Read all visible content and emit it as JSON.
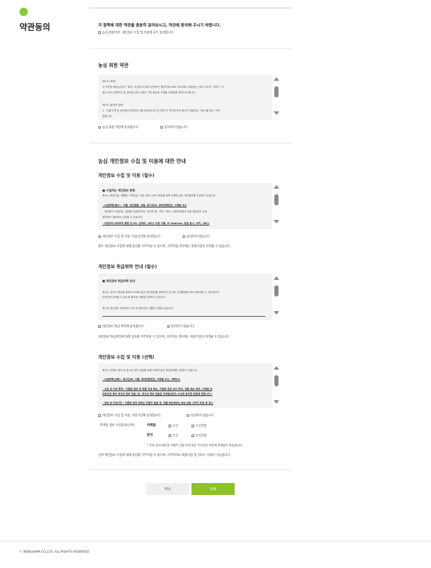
{
  "sidebar": {
    "title": "약관동의"
  },
  "intro": {
    "headline": "각 항목에 대한 약관을 충분히 읽어보시고, 약관에 동의해 주시기 바랍니다.",
    "agree_all": "농심 회원약관, 개인정보 수집 및 이용에 모두 동의합니다."
  },
  "member_terms": {
    "title": "농심 회원 약관",
    "lines": [
      "제1조 (목적)",
      "이 약관은 ㈜농심(이하 \"회사\" 라 합니다)에서 운영하는 웹사이트(Web Site)에서 제공하는 서비스(이하 \"서비스\" 라",
      "합니다)의 이용조건 및 절차에 관한 사항과 기타 필요한 사항을 규정함을 목적으로 합니다.",
      "제2조 (용어의 정의)",
      "1. \"이용고객\"은 회사에서 운영하는 웹사이트에 로그인 하여 이 약관에 따라 회사가 제공하는 서비스를 받는 고객",
      "말합니다."
    ],
    "agree": "농심 회원 약관에 동의합니다.",
    "disagree": "동의하지 않습니다."
  },
  "privacy": {
    "title": "농심 개인정보 수집 및 이용에 대한 안내",
    "required_collect": {
      "title": "개인정보 수집 및 이용 (필수)",
      "heading": "■ 수집하는 개인정보 항목",
      "lines": [
        "회사는 회원가입, 원활한 고객상담, 각종 서비스 등의 제공을 위해 아래와 같은 개인정보를 수집하고 있습니다.",
        "- 수집항목(필수) : 이름, 생년월일, 성별, 로그인ID, 휴대전화번호, 이메일 주소",
        "- 개인정보 수집방법 : 홈페이지(회원가입, 게시판 등), 모든 서비스 이용과정에서 자동 생성되어 수집",
        "정보들이 생성되어 수집될 수 있습니다.",
        "- 이용자의 브라우저 종류 및 OS, 검색어, 서비스 이용 기록, IP Address, 방문 일시, 쿠키, 서비스"
      ],
      "agree": "개인정보 수집 및 이용, 이용기간에 동의합니다.",
      "disagree": "동의하지 않습니다.",
      "note": "필수 개인정보 수집에 대해 동의를 거부하실 수 있으며, 거부하실 경우에는 회원가입이 어려울 수 있습니다."
    },
    "consign": {
      "title": "개인정보 취급위탁 안내 (필수)",
      "heading": "■ 개인정보 취급위탁 안내",
      "lines": [
        "회사는 서비스 향상을 위해서 아래와 같이 개인정보를 위탁하고 있으며, 관계법령에 따라 위탁계약 시 개인정보가",
        "안전하게 관리될 수 있도록 필요한 사항을 규정하고 있습니다.",
        "회사의 개인정보 위탁처리 기관 및 위탁업무 내용은 아래와 같습니다."
      ],
      "agree": "개인정보 취급 위탁에 동의합니다.",
      "disagree": "동의하지 않습니다.",
      "note": "개인정보 취급위탁에 대해 동의를 거부하실 수 있으며, 거부하실 경우에는 회원가입이 어려울 수 있습니다."
    },
    "optional_collect": {
      "title": "개인정보 수집 및 이용 (선택)",
      "lines": [
        "회사는 이벤트 참여 및 광고성 정보 전달을 위해 아래와 같은 개인정보를 수집하고 있습니다.",
        "- 수집항목(선택) : 로그인ID, 이름, 휴대전화번호, 이메일 주소, 자택주소",
        "- 수집 및 이용 목적 : 이벤트 참여 및 경품 지급 배송, 이벤트 관련 공지 처리, 경품 배송 정보, 이메일 및",
        "프로모션 등의 광고성 정보 전달 (단, 광고성 정보 전달은 이메일(문자) 수신에 동의한 회원에 한합니다.)",
        "- 보유 및 이용기간 : 이벤트 참여 정보는 당첨자 발표 후, 경품 배송정보는 배송 완료 시까지 보유 후 즉시"
      ],
      "agree": "개인정보 수집 및 이용, 이용기간에 동의합니다.",
      "disagree": "동의하지 않습니다.",
      "marketing_label": "· 마케팅 정보 수신동의(선택)",
      "email_label": "이메일",
      "sms_label": "문자",
      "receive": "수신",
      "reject": "수신안함",
      "marketing_note": "* 주요 공지사항 및 이벤트 당첨 안내 등은 수신동의 여부에 관계없이 발송됩니다.",
      "note": "선택 개인정보 수집에 대해 동의를 거부하실 수 있으며, 거부하여도 회원가입 및 서비스 이용이 가능합니다."
    }
  },
  "buttons": {
    "cancel": "취소",
    "confirm": "완료"
  },
  "footer": {
    "copyright": "ⓒ NONGSHIM CO.,LTD. ALL RIGHTS RESERVED."
  },
  "colors": {
    "accent": "#8cc221",
    "box_bg": "#f3f3f3"
  }
}
